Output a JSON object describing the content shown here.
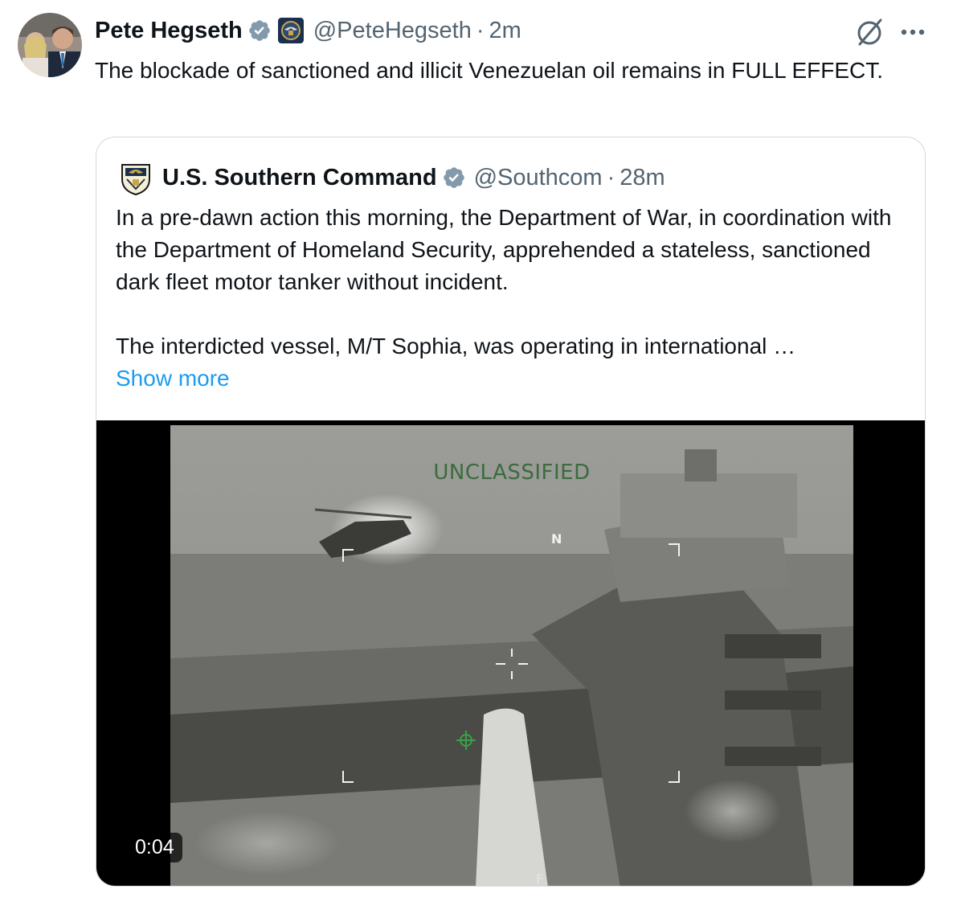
{
  "tweet": {
    "author_name": "Pete Hegseth",
    "handle": "@PeteHegseth",
    "separator": "·",
    "time": "2m",
    "text": "The blockade of sanctioned and illicit Venezuelan oil remains in FULL EFFECT.",
    "icons": {
      "verified": "verified-badge-icon",
      "affiliation": "dod-seal-icon",
      "grok": "grok-icon",
      "more": "more-options-icon"
    }
  },
  "quote": {
    "author_name": "U.S. Southern Command",
    "handle": "@Southcom",
    "separator": "·",
    "time": "28m",
    "paragraph1": "In a pre-dawn action this morning, the Department of War, in coordination with the Department of Homeland Security, apprehended a stateless, sanctioned dark fleet motor tanker without incident.",
    "paragraph2": "The interdicted vessel, M/T Sophia, was operating in international …",
    "show_more": "Show more",
    "video": {
      "overlay_label": "UNCLASSIFIED",
      "north_marker": "N",
      "bottom_marker": "F",
      "duration": "0:04"
    }
  },
  "colors": {
    "text": "#0f1419",
    "secondary": "#536471",
    "link": "#1d9bf0",
    "border": "#cfd9de",
    "verified_badge": "#829aab",
    "hud_green": "#3c6b3e"
  }
}
